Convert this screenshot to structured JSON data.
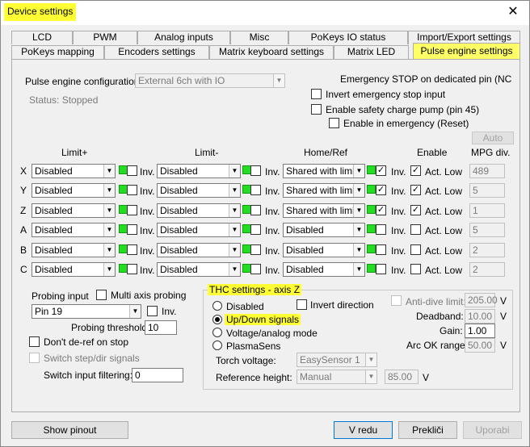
{
  "window": {
    "title": "Device settings"
  },
  "tabs_row1": [
    "LCD",
    "PWM",
    "Analog inputs",
    "Misc",
    "PoKeys IO status",
    "Import/Export settings"
  ],
  "tabs_row2": [
    "PoKeys mapping",
    "Encoders settings",
    "Matrix keyboard settings",
    "Matrix LED",
    "Pulse engine settings"
  ],
  "config": {
    "label": "Pulse engine configuration:",
    "value": "External 6ch with IO",
    "status": "Status: Stopped"
  },
  "estop": {
    "heading": "Emergency STOP on dedicated pin (NC switcl",
    "invert_label": "Invert emergency stop input",
    "charge_pump_label": "Enable safety charge pump (pin 45)",
    "enable_emergency_label": "Enable in emergency (Reset)"
  },
  "auto_label": "Auto",
  "headers": {
    "limit_plus": "Limit+",
    "limit_minus": "Limit-",
    "home": "Home/Ref",
    "enable": "Enable",
    "mpg": "MPG div."
  },
  "inv_label": "Inv.",
  "act_low_label": "Act. Low",
  "axes": [
    {
      "name": "X",
      "limit_plus": "Disabled",
      "limit_minus": "Disabled",
      "home": "Shared with limit-",
      "home_inv": true,
      "act_low": true,
      "mpg": "489"
    },
    {
      "name": "Y",
      "limit_plus": "Disabled",
      "limit_minus": "Disabled",
      "home": "Shared with limit-",
      "home_inv": true,
      "act_low": true,
      "mpg": "5"
    },
    {
      "name": "Z",
      "limit_plus": "Disabled",
      "limit_minus": "Disabled",
      "home": "Shared with limit+",
      "home_inv": true,
      "act_low": true,
      "mpg": "1"
    },
    {
      "name": "A",
      "limit_plus": "Disabled",
      "limit_minus": "Disabled",
      "home": "Disabled",
      "home_inv": false,
      "act_low": false,
      "mpg": "5"
    },
    {
      "name": "B",
      "limit_plus": "Disabled",
      "limit_minus": "Disabled",
      "home": "Disabled",
      "home_inv": false,
      "act_low": false,
      "mpg": "2"
    },
    {
      "name": "C",
      "limit_plus": "Disabled",
      "limit_minus": "Disabled",
      "home": "Disabled",
      "home_inv": false,
      "act_low": false,
      "mpg": "2"
    }
  ],
  "probing": {
    "label": "Probing input",
    "multi_axis_label": "Multi axis probing",
    "pin_value": "Pin 19",
    "threshold_label": "Probing threshold:",
    "threshold_value": "10",
    "deref_label": "Don't de-ref on stop",
    "switch_step_label": "Switch step/dir signals",
    "filter_label": "Switch input filtering:",
    "filter_value": "0"
  },
  "thc": {
    "title": "THC settings - axis Z",
    "modes": [
      "Disabled",
      "Up/Down signals",
      "Voltage/analog mode",
      "PlasmaSens"
    ],
    "selected_mode": 1,
    "invert_label": "Invert direction",
    "torch_label": "Torch voltage:",
    "torch_value": "EasySensor 1",
    "ref_label": "Reference height:",
    "ref_value": "Manual",
    "ref_height_value": "85.00",
    "ref_unit": "V",
    "anti_dive_label": "Anti-dive limit:",
    "anti_dive_value": "205.00",
    "deadband_label": "Deadband:",
    "deadband_value": "10.00",
    "gain_label": "Gain:",
    "gain_value": "1.00",
    "arc_ok_label": "Arc OK range:",
    "arc_ok_value": "50.00",
    "unit_v": "V"
  },
  "buttons": {
    "show_pinout": "Show pinout",
    "ok": "V redu",
    "cancel": "Prekliči",
    "apply": "Uporabi"
  }
}
